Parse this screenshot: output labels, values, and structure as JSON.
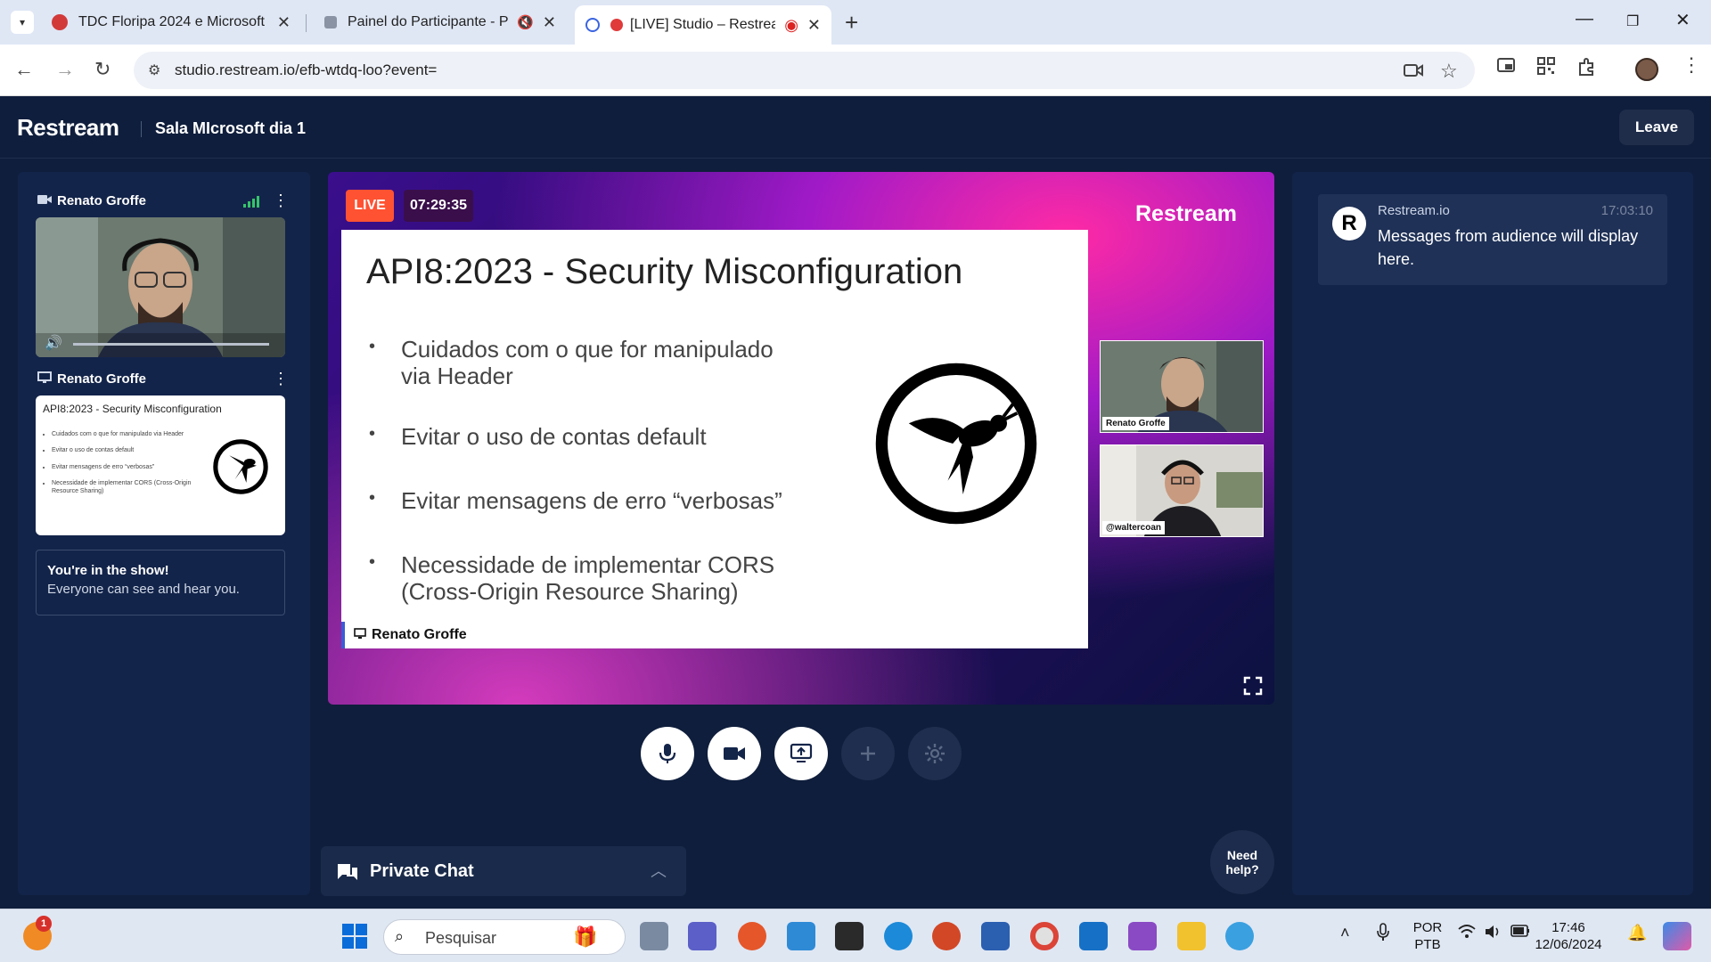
{
  "browser": {
    "tabs": [
      {
        "title": "TDC Floripa 2024 e Microsoft"
      },
      {
        "title": "Painel do Participante - Pow"
      },
      {
        "title": "[LIVE] Studio – Restream"
      }
    ],
    "url": "studio.restream.io/efb-wtdq-loo?event="
  },
  "header": {
    "logo": "Restream",
    "room_name": "Sala MIcrosoft dia 1",
    "leave_label": "Leave"
  },
  "sources": [
    {
      "name": "Renato Groffe",
      "type": "camera"
    },
    {
      "name": "Renato Groffe",
      "type": "screen"
    }
  ],
  "show_status": {
    "title": "You're in the show!",
    "subtitle": "Everyone can see and hear you."
  },
  "stage": {
    "live_label": "LIVE",
    "timer": "07:29:35",
    "brand": "Restream",
    "slide": {
      "title": "API8:2023 - Security Misconfiguration",
      "bullets": [
        "Cuidados com o que for manipulado via Header",
        "Evitar o uso de contas default",
        "Evitar mensagens de erro “verbosas”",
        "Necessidade de implementar CORS (Cross-Origin Resource Sharing)"
      ]
    },
    "presenter_tag": "Renato Groffe",
    "pip": [
      {
        "name": "Renato Groffe"
      },
      {
        "name": "@waltercoan"
      }
    ]
  },
  "thumb_slide": {
    "title": "API8:2023 - Security Misconfiguration",
    "bullets": [
      "Cuidados com o que for manipulado via Header",
      "Evitar o uso de contas default",
      "Evitar mensagens de erro “verbosas”",
      "Necessidade de implementar CORS (Cross-Origin Resource Sharing)"
    ]
  },
  "controls": [
    {
      "name": "microphone",
      "icon": "mic-icon"
    },
    {
      "name": "camera",
      "icon": "video-icon"
    },
    {
      "name": "share-screen",
      "icon": "share-screen-icon"
    },
    {
      "name": "add",
      "icon": "plus-icon"
    },
    {
      "name": "settings",
      "icon": "gear-icon"
    }
  ],
  "private_chat": {
    "label": "Private Chat"
  },
  "need_help": {
    "line1": "Need",
    "line2": "help?"
  },
  "chat": {
    "messages": [
      {
        "author": "Restream.io",
        "time": "17:03:10",
        "text": "Messages from audience will display here."
      }
    ]
  },
  "taskbar": {
    "search_placeholder": "Pesquisar",
    "notification_count": "1",
    "lang_line1": "POR",
    "lang_line2": "PTB",
    "time": "17:46",
    "date": "12/06/2024"
  },
  "colors": {
    "app_bg": "#0f1e3c",
    "panel_bg": "#13244a",
    "live": "#ff5232",
    "signal": "#35c46a"
  }
}
